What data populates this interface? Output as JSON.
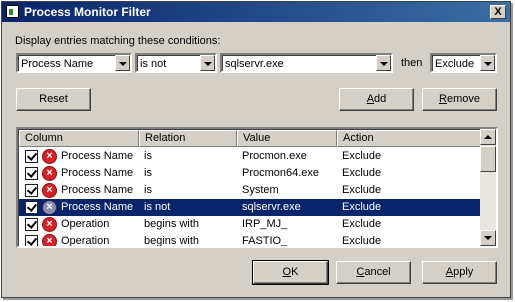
{
  "window": {
    "title": "Process Monitor Filter",
    "close_label": "X"
  },
  "conditions": {
    "label": "Display entries matching these conditions:",
    "column": "Process Name",
    "relation": "is not",
    "value": "sqlservr.exe",
    "then_label": "then",
    "action": "Exclude"
  },
  "buttons": {
    "reset": "Reset",
    "add": {
      "pre": "",
      "accel": "A",
      "post": "dd"
    },
    "remove": {
      "pre": "",
      "accel": "R",
      "post": "emove"
    },
    "ok": {
      "pre": "",
      "accel": "O",
      "post": "K"
    },
    "cancel": {
      "pre": "",
      "accel": "C",
      "post": "ancel"
    },
    "apply": {
      "pre": "",
      "accel": "A",
      "post": "pply"
    }
  },
  "list": {
    "headers": [
      "Column",
      "Relation",
      "Value",
      "Action"
    ],
    "rows": [
      {
        "column": "Process Name",
        "relation": "is",
        "value": "Procmon.exe",
        "action": "Exclude"
      },
      {
        "column": "Process Name",
        "relation": "is",
        "value": "Procmon64.exe",
        "action": "Exclude"
      },
      {
        "column": "Process Name",
        "relation": "is",
        "value": "System",
        "action": "Exclude"
      },
      {
        "column": "Process Name",
        "relation": "is not",
        "value": "sqlservr.exe",
        "action": "Exclude"
      },
      {
        "column": "Operation",
        "relation": "begins with",
        "value": "IRP_MJ_",
        "action": "Exclude"
      },
      {
        "column": "Operation",
        "relation": "begins with",
        "value": "FASTIO_",
        "action": "Exclude"
      }
    ],
    "selected_index": 3
  },
  "icons": {
    "exclude": "x-circle-icon",
    "checkbox": "checkbox-checked-icon"
  },
  "colors": {
    "title_start": "#0a246a",
    "title_end": "#3a6ea5",
    "selection": "#0a246a",
    "exclude_icon": "#d8222a"
  }
}
